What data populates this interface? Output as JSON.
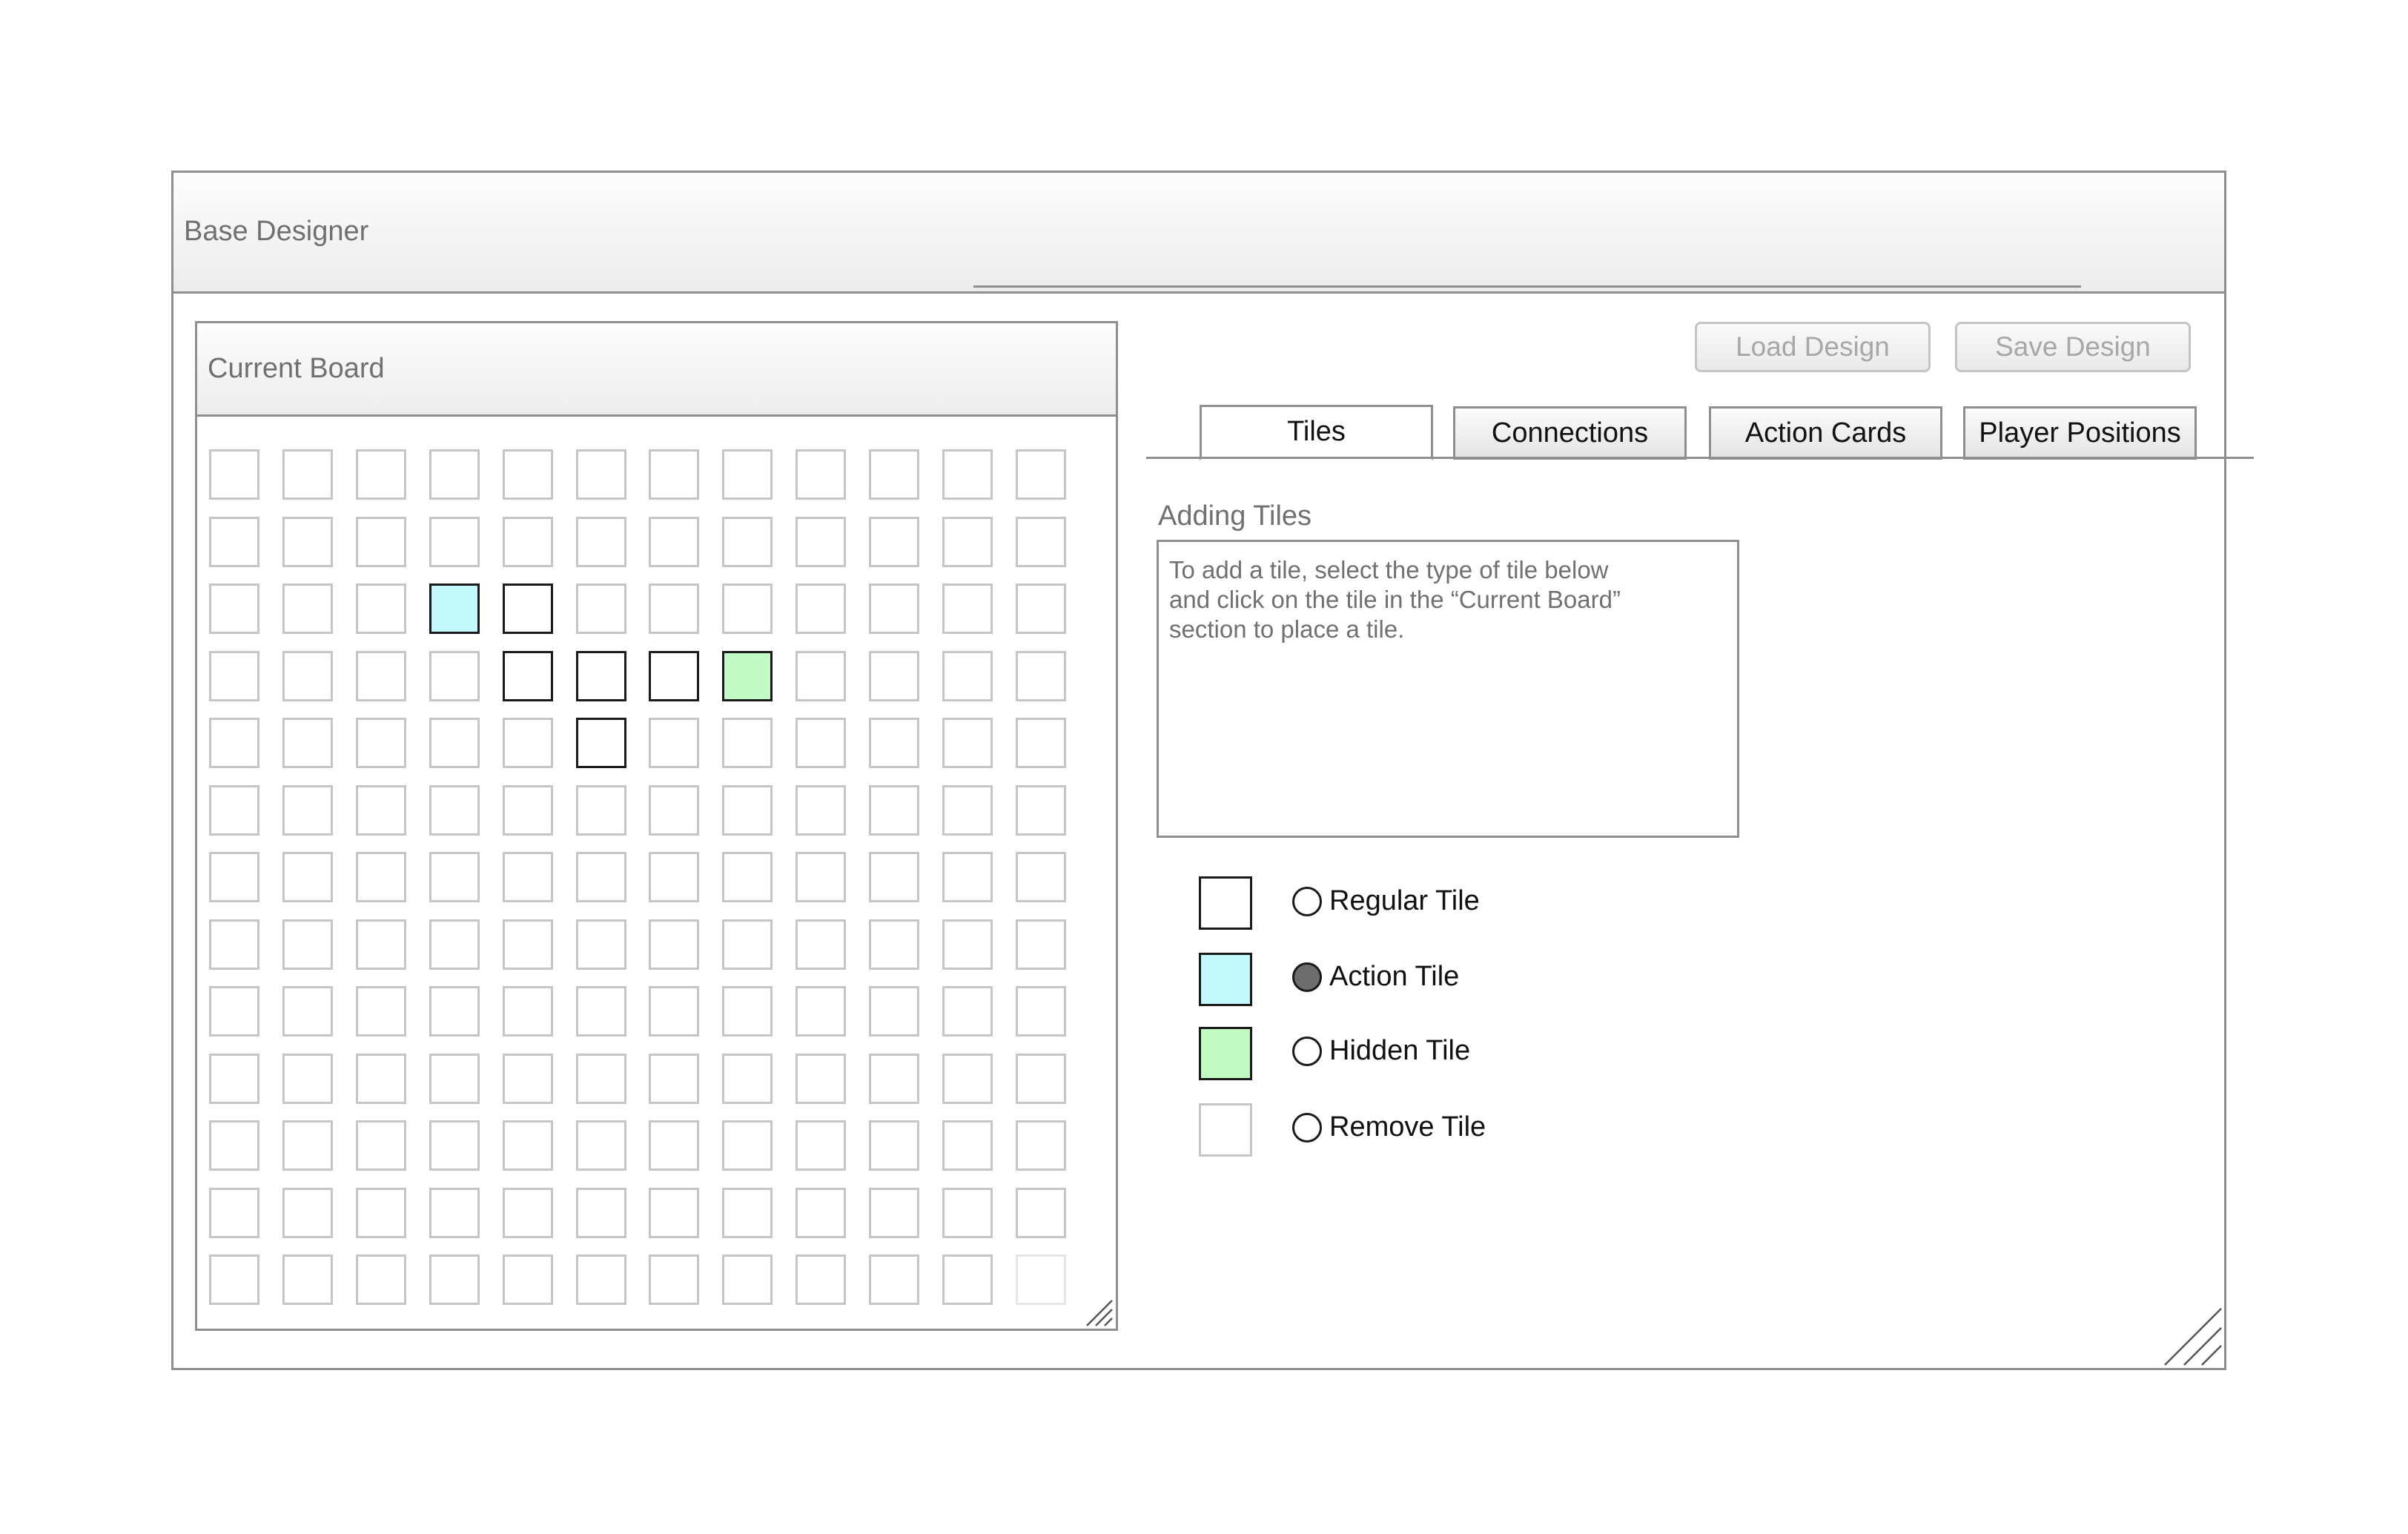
{
  "window": {
    "title": "Base Designer"
  },
  "board": {
    "title": "Current Board",
    "rows": 13,
    "cols": 12,
    "cells": [
      {
        "row": 2,
        "col": 3,
        "type": "action"
      },
      {
        "row": 2,
        "col": 4,
        "type": "regular"
      },
      {
        "row": 3,
        "col": 4,
        "type": "regular"
      },
      {
        "row": 3,
        "col": 5,
        "type": "regular"
      },
      {
        "row": 3,
        "col": 6,
        "type": "regular"
      },
      {
        "row": 3,
        "col": 7,
        "type": "hidden"
      },
      {
        "row": 4,
        "col": 5,
        "type": "regular"
      }
    ]
  },
  "toolbar": {
    "load_label": "Load Design",
    "save_label": "Save Design"
  },
  "tabs": [
    {
      "label": "Tiles",
      "active": true
    },
    {
      "label": "Connections",
      "active": false
    },
    {
      "label": "Action Cards",
      "active": false
    },
    {
      "label": "Player Positions",
      "active": false
    }
  ],
  "tiles_panel": {
    "section_title": "Adding Tiles",
    "instructions": "To add a tile, select the type of tile below\nand click on the tile in the “Current Board”\nsection to place a tile.",
    "options": [
      {
        "label": "Regular Tile",
        "swatch": "regular",
        "selected": false
      },
      {
        "label": "Action Tile",
        "swatch": "action",
        "selected": true
      },
      {
        "label": "Hidden Tile",
        "swatch": "hidden",
        "selected": false
      },
      {
        "label": "Remove Tile",
        "swatch": "remove",
        "selected": false
      }
    ]
  },
  "colors": {
    "action_tile": "#c4f9fb",
    "hidden_tile": "#c2fcc4",
    "border": "#8f8f8f"
  }
}
